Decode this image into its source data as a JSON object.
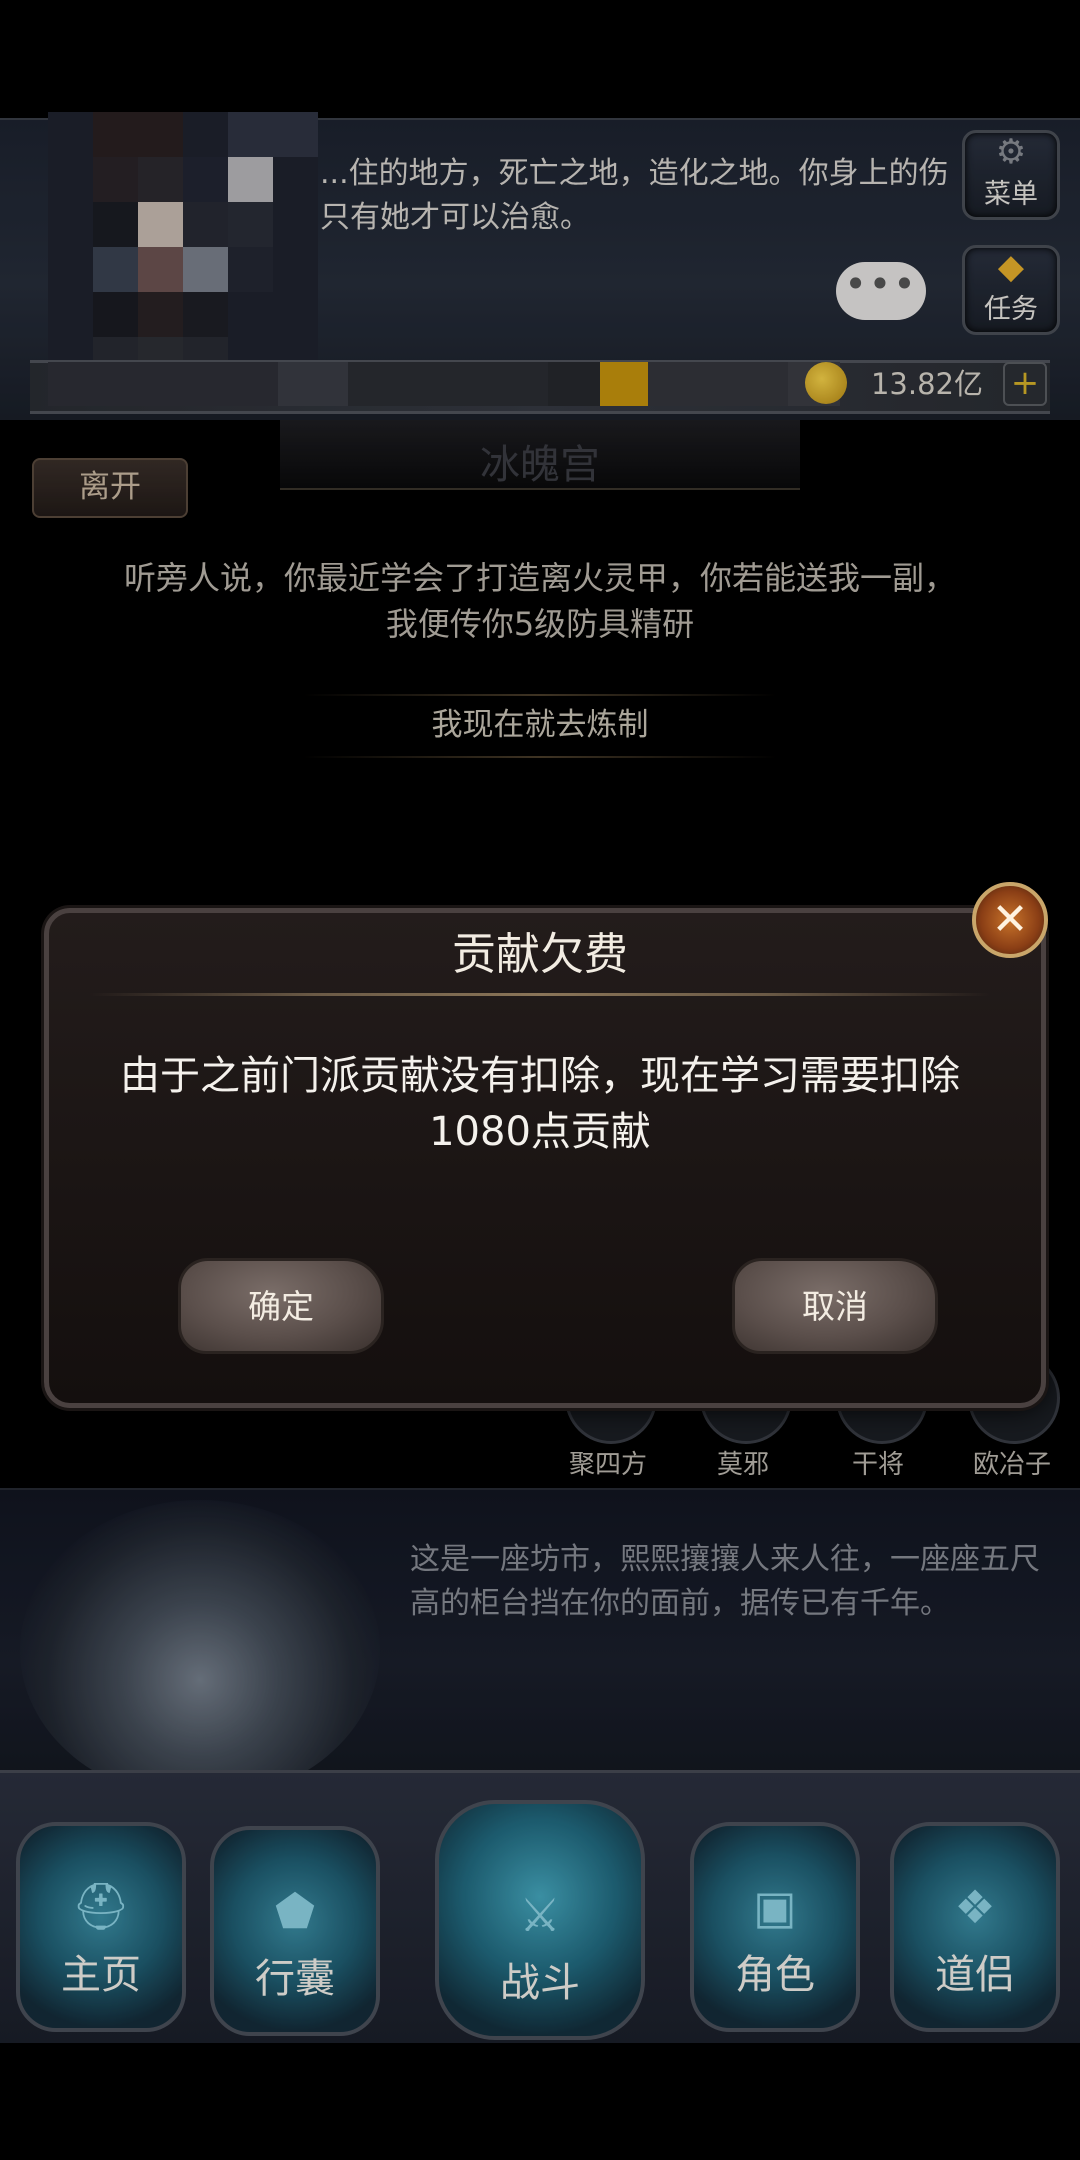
{
  "header": {
    "story_text": "...住的地方，死亡之地，造化之地。你身上的伤只有她才可以治愈。",
    "menu_label": "菜单",
    "task_label": "任务",
    "chat_bubble": "•••",
    "gold_amount": "13.82亿",
    "gold_add": "+"
  },
  "scene": {
    "title": "冰魄宫",
    "leave_label": "离开",
    "npc_speech": "听旁人说，你最近学会了打造离火灵甲，你若能送我一副，我便传你5级防具精研",
    "reply_option": "我现在就去炼制"
  },
  "npcs": [
    {
      "name": "聚四方"
    },
    {
      "name": "莫邪"
    },
    {
      "name": "干将"
    },
    {
      "name": "欧冶子"
    }
  ],
  "location": {
    "description": "这是一座坊市，熙熙攘攘人来人往，一座座五尺高的柜台挡在你的面前，据传已有千年。"
  },
  "bottom_nav": [
    {
      "label": "主页",
      "icon": "helmet-icon"
    },
    {
      "label": "行囊",
      "icon": "bag-icon"
    },
    {
      "label": "战斗",
      "icon": "sword-icon"
    },
    {
      "label": "角色",
      "icon": "chest-icon"
    },
    {
      "label": "道侣",
      "icon": "companion-icon"
    }
  ],
  "modal": {
    "title": "贡献欠费",
    "message": "由于之前门派贡献没有扣除，现在学习需要扣除1080点贡献",
    "confirm_label": "确定",
    "cancel_label": "取消",
    "close_glyph": "✕"
  },
  "colors": {
    "gold": "#e8b02c",
    "modal_bg": "#1b1514",
    "nav_teal": "#2a7a90"
  }
}
